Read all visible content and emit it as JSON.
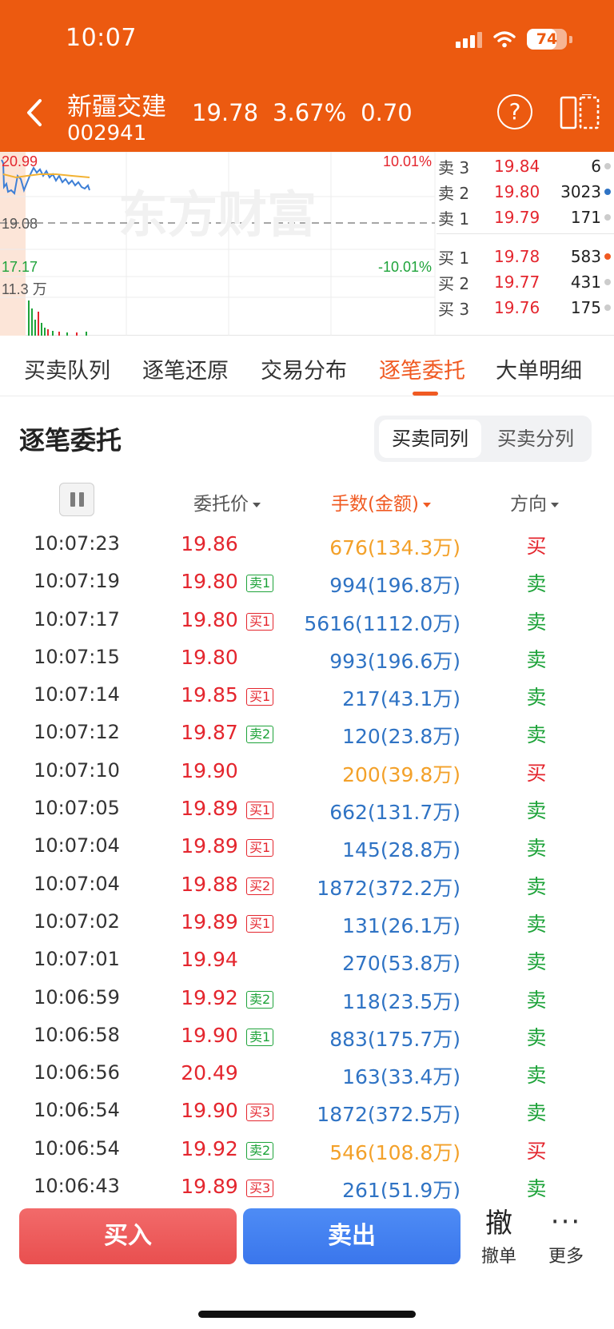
{
  "status_bar": {
    "time": "10:07",
    "battery": "74",
    "battery_level": 0.74
  },
  "header": {
    "name": "新疆交建",
    "code": "002941",
    "price": "19.78",
    "change_pct": "3.67%",
    "change": "0.70"
  },
  "chart": {
    "high_label": "20.99",
    "prev_close_label": "19.08",
    "low_label": "17.17",
    "up_pct": "10.01%",
    "down_pct": "-10.01%",
    "vol_label": "11.3 万",
    "watermark": "东方财富"
  },
  "order_book": [
    {
      "label": "卖 3",
      "price": "19.84",
      "vol": "6",
      "dot": "#cccccc"
    },
    {
      "label": "卖 2",
      "price": "19.80",
      "vol": "3023",
      "dot": "#2F73C4"
    },
    {
      "label": "卖 1",
      "price": "19.79",
      "vol": "171",
      "dot": "#cccccc"
    },
    {
      "label": "买 1",
      "price": "19.78",
      "vol": "583",
      "dot": "#F05A22"
    },
    {
      "label": "买 2",
      "price": "19.77",
      "vol": "431",
      "dot": "#cccccc"
    },
    {
      "label": "买 3",
      "price": "19.76",
      "vol": "175",
      "dot": "#cccccc"
    }
  ],
  "tabs": [
    "买卖队列",
    "逐笔还原",
    "交易分布",
    "逐笔委托",
    "大单明细"
  ],
  "section": {
    "title": "逐笔委托",
    "seg_active": "买卖同列",
    "seg_inactive": "买卖分列"
  },
  "columns": {
    "price": "委托价",
    "amount": "手数(金额)",
    "direction": "方向"
  },
  "rows": [
    {
      "time": "10:07:23",
      "price": "19.86",
      "tag": "",
      "amount": "676(134.3万)",
      "dir": "买"
    },
    {
      "time": "10:07:19",
      "price": "19.80",
      "tag": "卖1",
      "amount": "994(196.8万)",
      "dir": "卖"
    },
    {
      "time": "10:07:17",
      "price": "19.80",
      "tag": "买1",
      "amount": "5616(1112.0万)",
      "dir": "卖"
    },
    {
      "time": "10:07:15",
      "price": "19.80",
      "tag": "",
      "amount": "993(196.6万)",
      "dir": "卖"
    },
    {
      "time": "10:07:14",
      "price": "19.85",
      "tag": "买1",
      "amount": "217(43.1万)",
      "dir": "卖"
    },
    {
      "time": "10:07:12",
      "price": "19.87",
      "tag": "卖2",
      "amount": "120(23.8万)",
      "dir": "卖"
    },
    {
      "time": "10:07:10",
      "price": "19.90",
      "tag": "",
      "amount": "200(39.8万)",
      "dir": "买"
    },
    {
      "time": "10:07:05",
      "price": "19.89",
      "tag": "买1",
      "amount": "662(131.7万)",
      "dir": "卖"
    },
    {
      "time": "10:07:04",
      "price": "19.89",
      "tag": "买1",
      "amount": "145(28.8万)",
      "dir": "卖"
    },
    {
      "time": "10:07:04",
      "price": "19.88",
      "tag": "买2",
      "amount": "1872(372.2万)",
      "dir": "卖"
    },
    {
      "time": "10:07:02",
      "price": "19.89",
      "tag": "买1",
      "amount": "131(26.1万)",
      "dir": "卖"
    },
    {
      "time": "10:07:01",
      "price": "19.94",
      "tag": "",
      "amount": "270(53.8万)",
      "dir": "卖"
    },
    {
      "time": "10:06:59",
      "price": "19.92",
      "tag": "卖2",
      "amount": "118(23.5万)",
      "dir": "卖"
    },
    {
      "time": "10:06:58",
      "price": "19.90",
      "tag": "卖1",
      "amount": "883(175.7万)",
      "dir": "卖"
    },
    {
      "time": "10:06:56",
      "price": "20.49",
      "tag": "",
      "amount": "163(33.4万)",
      "dir": "卖"
    },
    {
      "time": "10:06:54",
      "price": "19.90",
      "tag": "买3",
      "amount": "1872(372.5万)",
      "dir": "卖"
    },
    {
      "time": "10:06:54",
      "price": "19.92",
      "tag": "卖2",
      "amount": "546(108.8万)",
      "dir": "买"
    },
    {
      "time": "10:06:43",
      "price": "19.89",
      "tag": "买3",
      "amount": "261(51.9万)",
      "dir": "卖"
    }
  ],
  "bottom": {
    "buy": "买入",
    "sell": "卖出",
    "cancel_big": "撤",
    "cancel_small": "撤单",
    "more_dots": "···",
    "more_small": "更多"
  },
  "colors": {
    "header_bg": "#EC5A10",
    "up": "#E4262E",
    "down": "#1EA33A",
    "blue": "#2F73C4",
    "accent": "#F05A22"
  }
}
